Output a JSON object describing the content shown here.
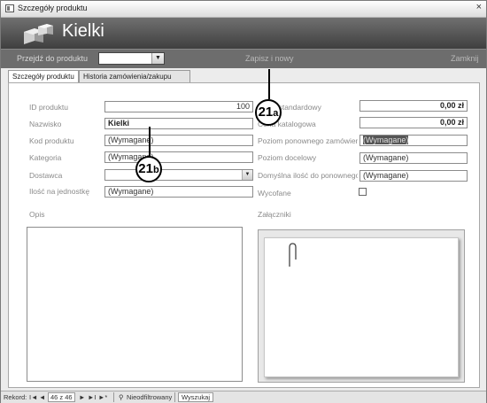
{
  "window": {
    "title": "Szczegóły produktu",
    "close_glyph": "×"
  },
  "header": {
    "title": "Kielki"
  },
  "navbar": {
    "goto_label": "Przejdź do produktu",
    "goto_value": "",
    "save_new": "Zapisz i nowy",
    "close": "Zamknij"
  },
  "tabs": [
    {
      "label": "Szczegóły produktu",
      "active": true
    },
    {
      "label": "Historia zamówienia/zakupu",
      "active": false
    }
  ],
  "left_fields": [
    {
      "label": "ID produktu",
      "value": "100"
    },
    {
      "label": "Nazwisko",
      "value": "Kielki"
    },
    {
      "label": "Kod produktu",
      "value": "(Wymagane)"
    },
    {
      "label": "Kategoria",
      "value": "(Wymagane)"
    },
    {
      "label": "Dostawca",
      "value": ""
    },
    {
      "label": "Ilość na jednostkę",
      "value": "(Wymagane)"
    }
  ],
  "right_fields": [
    {
      "label": "Koszt standardowy",
      "value": "0,00 zł"
    },
    {
      "label": "Cena katalogowa",
      "value": "0,00 zł"
    },
    {
      "label": "Poziom ponownego zamówienia",
      "value": "(Wymagane)"
    },
    {
      "label": "Poziom docelowy",
      "value": "(Wymagane)"
    },
    {
      "label": "Domyślna ilość do ponownego zamówienia",
      "value": "(Wymagane)"
    },
    {
      "label": "Wycofane",
      "value": ""
    }
  ],
  "opis_label": "Opis",
  "attachments_label": "Załączniki",
  "callouts": {
    "a_num": "21",
    "a_sub": "a",
    "b_num": "21",
    "b_sub": "b"
  },
  "statusbar": {
    "record_label": "Rekord:",
    "first": "I◄",
    "prev": "◄",
    "position": "46 z 46",
    "next": "►",
    "last": "►I",
    "new": "►*",
    "filter": "Nieodfiltrowany",
    "search": "Wyszukaj"
  }
}
